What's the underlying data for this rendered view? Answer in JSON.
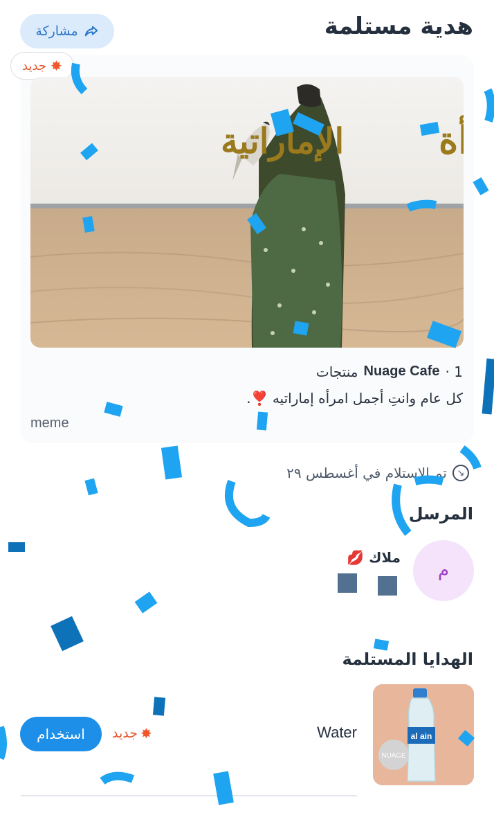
{
  "header": {
    "title": "هدية مستلمة",
    "share_label": "مشاركة"
  },
  "badge": {
    "new_label": "جديد"
  },
  "hero": {
    "calligraphy_right": "يوم المرأة",
    "calligraphy_left": "الإماراتية"
  },
  "gift_card": {
    "count": "1 ·",
    "store_name": "Nuage Cafe",
    "products_label": "منتجات",
    "message": "كل عام وانتِ أجمل امرأه إماراتيه ❣️.",
    "meme": "meme"
  },
  "received": {
    "text": "تم الاستلام في أغسطس ٢٩"
  },
  "sender": {
    "section_title": "المرسل",
    "avatar_initial": "م",
    "name": "ملاك 💋"
  },
  "gifts": {
    "section_title": "الهدايا المستلمة",
    "items": [
      {
        "name": "Water",
        "new_label": "جديد",
        "use_label": "استخدام",
        "thumb_brand": "al ain",
        "thumb_logo": "NUAGE"
      }
    ]
  },
  "colors": {
    "accent": "#1d8fe8",
    "share_bg": "#dcebfb",
    "new_badge": "#e4552a",
    "avatar_bg": "#f4e3fa",
    "confetti_light": "#1ea4f0",
    "confetti_dark": "#0d72b8"
  }
}
